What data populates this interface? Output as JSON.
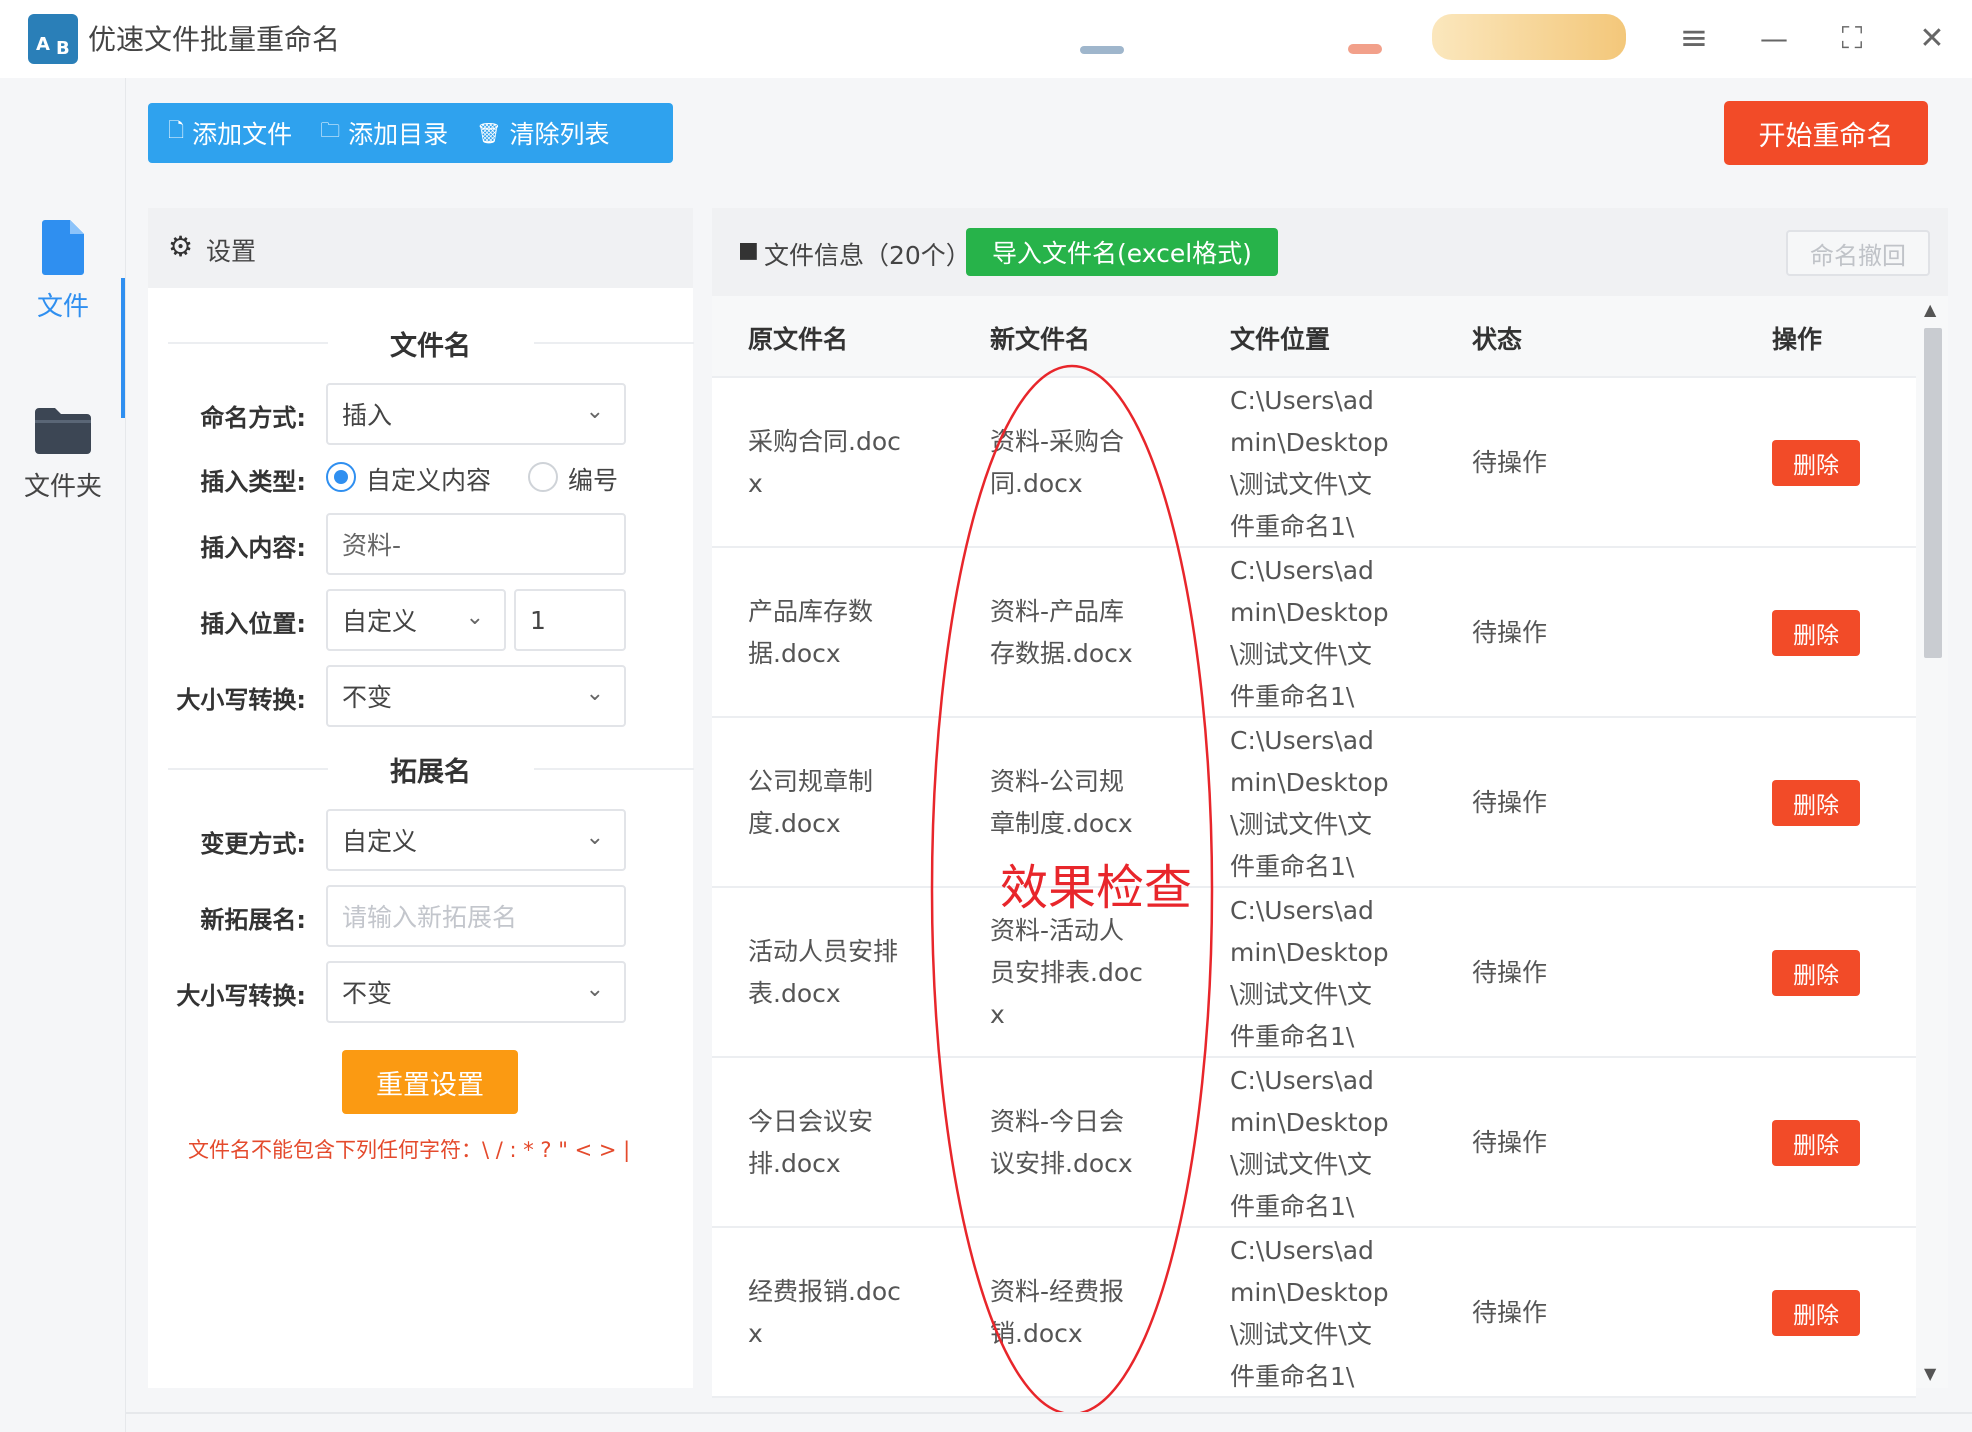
{
  "app": {
    "title": "优速文件批量重命名",
    "logo_letters": [
      "A",
      "B"
    ]
  },
  "window_controls": {
    "menu": "≡",
    "minimize": "—",
    "maximize": "⛶",
    "close": "✕"
  },
  "nav": [
    {
      "label": "文件",
      "icon": "file-icon",
      "active": true
    },
    {
      "label": "文件夹",
      "icon": "folder-icon",
      "active": false
    }
  ],
  "toolbar": {
    "add_file": "添加文件",
    "add_dir": "添加目录",
    "clear_list": "清除列表",
    "start_rename": "开始重命名"
  },
  "settings": {
    "title": "设置",
    "filename_section": "文件名",
    "naming_mode_label": "命名方式:",
    "naming_mode_value": "插入",
    "insert_type_label": "插入类型:",
    "insert_type_options": [
      "自定义内容",
      "编号"
    ],
    "insert_type_selected": "自定义内容",
    "insert_content_label": "插入内容:",
    "insert_content_value": "资料-",
    "insert_pos_label": "插入位置:",
    "insert_pos_value": "自定义",
    "insert_pos_number": "1",
    "case_label": "大小写转换:",
    "case_value": "不变",
    "ext_section": "拓展名",
    "ext_mode_label": "变更方式:",
    "ext_mode_value": "自定义",
    "new_ext_label": "新拓展名:",
    "new_ext_placeholder": "请输入新拓展名",
    "ext_case_label": "大小写转换:",
    "ext_case_value": "不变",
    "reset_button": "重置设置",
    "warning": "文件名不能包含下列任何字符：\\ / : * ? \" < > |"
  },
  "files": {
    "title": "文件信息（20个）",
    "import_button": "导入文件名(excel格式)",
    "undo_button": "命名撤回",
    "columns": [
      "原文件名",
      "新文件名",
      "文件位置",
      "状态",
      "操作"
    ],
    "rows": [
      {
        "orig": [
          "采购合同.doc",
          "x"
        ],
        "newn": [
          "资料-采购合",
          "同.docx"
        ],
        "loc": [
          "C:\\Users\\ad",
          "min\\Desktop",
          "\\测试文件\\文",
          "件重命名1\\"
        ],
        "status": "待操作",
        "action": "删除"
      },
      {
        "orig": [
          "产品库存数",
          "据.docx"
        ],
        "newn": [
          "资料-产品库",
          "存数据.docx"
        ],
        "loc": [
          "C:\\Users\\ad",
          "min\\Desktop",
          "\\测试文件\\文",
          "件重命名1\\"
        ],
        "status": "待操作",
        "action": "删除"
      },
      {
        "orig": [
          "公司规章制",
          "度.docx"
        ],
        "newn": [
          "资料-公司规",
          "章制度.docx"
        ],
        "loc": [
          "C:\\Users\\ad",
          "min\\Desktop",
          "\\测试文件\\文",
          "件重命名1\\"
        ],
        "status": "待操作",
        "action": "删除"
      },
      {
        "orig": [
          "活动人员安排",
          "表.docx"
        ],
        "newn": [
          "资料-活动人",
          "员安排表.doc",
          "x"
        ],
        "loc": [
          "C:\\Users\\ad",
          "min\\Desktop",
          "\\测试文件\\文",
          "件重命名1\\"
        ],
        "status": "待操作",
        "action": "删除"
      },
      {
        "orig": [
          "今日会议安",
          "排.docx"
        ],
        "newn": [
          "资料-今日会",
          "议安排.docx"
        ],
        "loc": [
          "C:\\Users\\ad",
          "min\\Desktop",
          "\\测试文件\\文",
          "件重命名1\\"
        ],
        "status": "待操作",
        "action": "删除"
      },
      {
        "orig": [
          "经费报销.doc",
          "x"
        ],
        "newn": [
          "资料-经费报",
          "销.docx"
        ],
        "loc": [
          "C:\\Users\\ad",
          "min\\Desktop",
          "\\测试文件\\文",
          "件重命名1\\"
        ],
        "status": "待操作",
        "action": "删除"
      }
    ]
  },
  "annotation": {
    "text": "效果检查",
    "color": "#e8262b"
  },
  "colors": {
    "accent": "#2fa2ee",
    "danger": "#f24b28",
    "success": "#27b34a",
    "warning": "#fb9a12"
  }
}
